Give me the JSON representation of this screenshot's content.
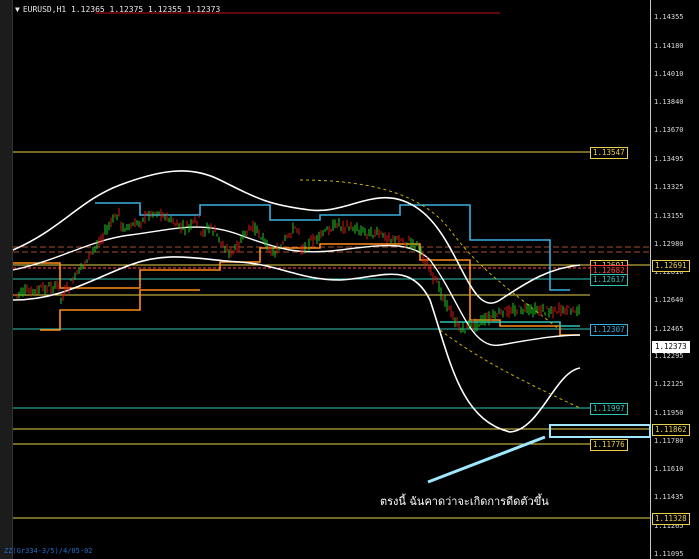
{
  "header": {
    "symbol_line": "EURUSD,H1  1.12365 1.12375 1.12355 1.12373"
  },
  "footer": {
    "indicator_label": "ZZ(Gr334-3/5)/4/05-02"
  },
  "annotation": {
    "text": "ตรงนี้ ฉันคาดว่าจะเกิดการดีดตัวขึ้น",
    "color": "#9fe8ff"
  },
  "axis": {
    "ticks": [
      "1.14355",
      "1.14180",
      "1.14010",
      "1.13840",
      "1.13670",
      "1.13495",
      "1.13325",
      "1.13155",
      "1.12980",
      "1.12810",
      "1.12640",
      "1.12465",
      "1.12295",
      "1.12125",
      "1.11950",
      "1.11780",
      "1.11610",
      "1.11435",
      "1.11265",
      "1.11095"
    ]
  },
  "chart_tags": [
    {
      "text": "1.13547",
      "color": "#e8d04a"
    },
    {
      "text": "1.12691",
      "color": "#e8d04a"
    },
    {
      "text": "1.12682",
      "color": "#ff4040"
    },
    {
      "text": "1.12617",
      "color": "#2ec4b6"
    },
    {
      "text": "1.12307",
      "color": "#3ab0e0"
    },
    {
      "text": "1.11997",
      "color": "#2ec4b6"
    },
    {
      "text": "1.11776",
      "color": "#e8d04a"
    }
  ],
  "axis_tags": [
    {
      "text": "1.12691",
      "color": "#e8d04a"
    },
    {
      "text": "1.12373",
      "color": "#ffffff"
    },
    {
      "text": "1.11862",
      "color": "#e8d04a"
    },
    {
      "text": "1.11328",
      "color": "#e8d04a"
    }
  ],
  "colors": {
    "background": "#000000",
    "bull_candle": "#22c422",
    "bear_candle": "#d01818",
    "bands": "#ffffff",
    "level_yellow": "#e8d04a",
    "level_cyan": "#2ec4b6",
    "level_blue": "#3ab0e0",
    "level_orange": "#ff8c1a",
    "zone_box": "#9fe8ff"
  }
}
